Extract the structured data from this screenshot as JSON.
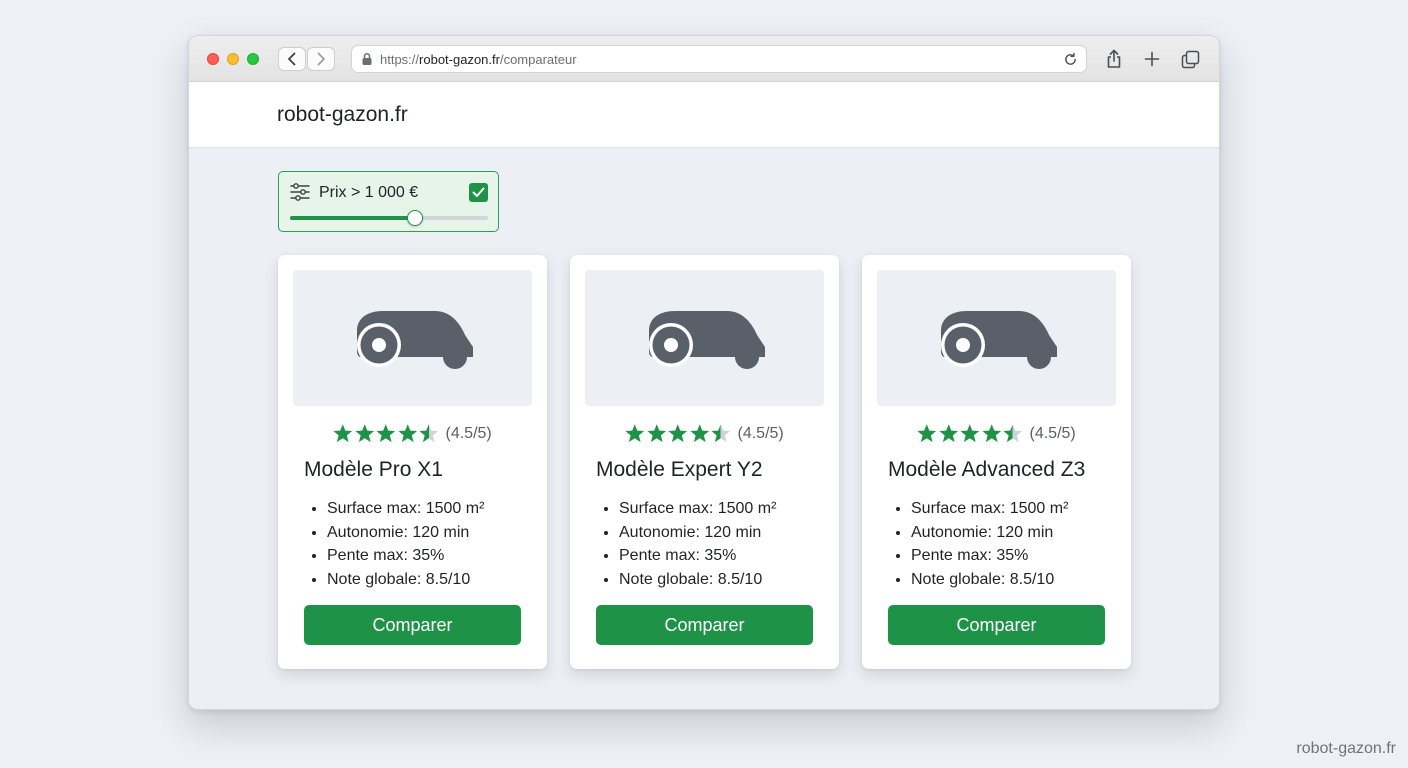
{
  "browser": {
    "url_prefix": "https://",
    "url_domain": "robot-gazon.fr",
    "url_path": "/comparateur",
    "icons": [
      "lock-icon",
      "reload-icon",
      "share-icon",
      "new-tab-icon",
      "tabs-overview-icon"
    ]
  },
  "site": {
    "brand": "robot-gazon.fr"
  },
  "filter": {
    "label": "Prix > 1 000 €",
    "checked": true,
    "slider_value_fraction": 0.63,
    "icon": "sliders-icon"
  },
  "cards": [
    {
      "name": "Modèle Pro X1",
      "rating": 4.5,
      "rating_text": "(4.5/5)",
      "specs": [
        "Surface max: 1500 m²",
        "Autonomie: 120 min",
        "Pente max: 35%",
        "Note globale: 8.5/10"
      ],
      "button": "Comparer",
      "image_icon": "robot-mower-icon"
    },
    {
      "name": "Modèle Expert Y2",
      "rating": 4.5,
      "rating_text": "(4.5/5)",
      "specs": [
        "Surface max: 1500 m²",
        "Autonomie: 120 min",
        "Pente max: 35%",
        "Note globale: 8.5/10"
      ],
      "button": "Comparer",
      "image_icon": "robot-mower-icon"
    },
    {
      "name": "Modèle Advanced Z3",
      "rating": 4.5,
      "rating_text": "(4.5/5)",
      "specs": [
        "Surface max: 1500 m²",
        "Autonomie: 120 min",
        "Pente max: 35%",
        "Note globale: 8.5/10"
      ],
      "button": "Comparer",
      "image_icon": "robot-mower-icon"
    }
  ],
  "watermark": "robot-gazon.fr",
  "colors": {
    "accent_green": "#1e9348",
    "filter_bg": "#e6f4ea",
    "star_empty": "#cfd3d7",
    "mower_gray": "#5a6069",
    "page_bg": "#edf0f4"
  }
}
